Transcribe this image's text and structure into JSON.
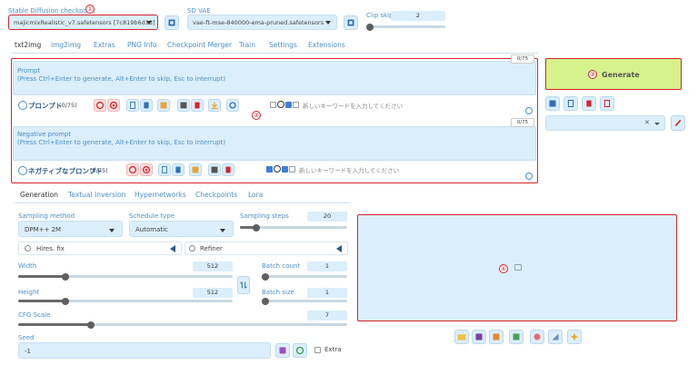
{
  "header": {
    "checkpoint_label": "Stable Diffusion checkpoint",
    "checkpoint_value": "majicmixRealistic_v7.safetensors [7c819b6d13]",
    "vae_label": "SD VAE",
    "vae_value": "vae-ft-mse-840000-ema-pruned.safetensors",
    "clip_label": "Clip skip",
    "clip_value": "2",
    "clip_fraction": 0.05
  },
  "tabs": [
    "txt2img",
    "img2img",
    "Extras",
    "PNG Info",
    "Checkpoint Merger",
    "Train",
    "Settings",
    "Extensions"
  ],
  "markers": {
    "m1": "①",
    "m2": "②",
    "m3": "③",
    "m4": "④"
  },
  "prompt": {
    "label": "Prompt",
    "placeholder": "(Press Ctrl+Enter to generate, Alt+Enter to skip, Esc to interrupt)",
    "counter": "0/75",
    "toolbar_title": "プロンプト",
    "toolbar_count": "(0/75)",
    "keyword_placeholder": "新しいキーワードを入力してください"
  },
  "negative": {
    "label": "Negative prompt",
    "placeholder": "(Press Ctrl+Enter to generate, Alt+Enter to skip, Esc to interrupt)",
    "counter": "0/75",
    "toolbar_title": "ネガティブなプロンプト",
    "toolbar_count": "(0/75)",
    "keyword_placeholder": "新しいキーワードを入力してください"
  },
  "generate": {
    "label": "Generate",
    "color": "#d5f28c"
  },
  "sub_tabs": [
    "Generation",
    "Textual Inversion",
    "Hypernetworks",
    "Checkpoints",
    "Lora"
  ],
  "sampling": {
    "method_label": "Sampling method",
    "method_value": "DPM++ 2M",
    "schedule_label": "Schedule type",
    "schedule_value": "Automatic",
    "steps_label": "Sampling steps",
    "steps_value": "20",
    "steps_fraction": 0.15
  },
  "hires": {
    "label": "Hires. fix"
  },
  "refiner": {
    "label": "Refiner"
  },
  "width": {
    "label": "Width",
    "value": "512",
    "fraction": 0.22
  },
  "height": {
    "label": "Height",
    "value": "512",
    "fraction": 0.22
  },
  "batch_count": {
    "label": "Batch count",
    "value": "1"
  },
  "batch_size": {
    "label": "Batch size",
    "value": "1"
  },
  "cfg": {
    "label": "CFG Scale",
    "value": "7",
    "fraction": 0.22
  },
  "seed": {
    "label": "Seed",
    "value": "-1",
    "extra_label": "Extra"
  }
}
